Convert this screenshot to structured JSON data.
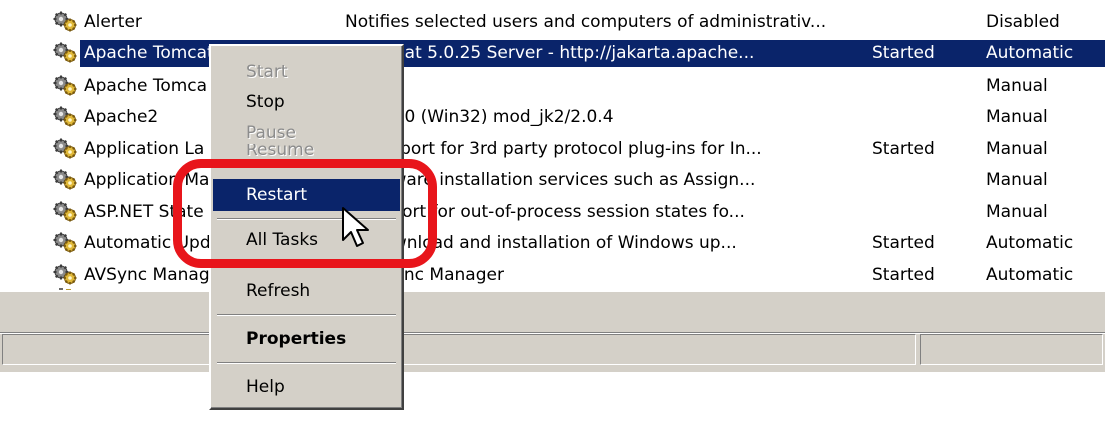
{
  "services": [
    {
      "name": "Alerter",
      "description": "Notifies selected users and computers of administrativ...",
      "status": "",
      "startup": "Disabled",
      "selected": false
    },
    {
      "name": "Apache Tomcat",
      "description": "e Tomcat 5.0.25 Server - http://jakarta.apache...",
      "status": "Started",
      "startup": "Automatic",
      "selected": true
    },
    {
      "name": "Apache Tomca",
      "description": "",
      "status": "",
      "startup": "Manual",
      "selected": false
    },
    {
      "name": "Apache2",
      "description": "e/2.0.50 (Win32) mod_jk2/2.0.4",
      "status": "",
      "startup": "Manual",
      "selected": false
    },
    {
      "name": "Application La",
      "description": "es support for 3rd party protocol plug-ins for In...",
      "status": "Started",
      "startup": "Manual",
      "selected": false
    },
    {
      "name": "Application Ma",
      "description": "es oftware installation services such as Assign...",
      "status": "",
      "startup": "Manual",
      "selected": false
    },
    {
      "name": "ASP.NET State",
      "description": "es upport for out-of-process session states fo...",
      "status": "",
      "startup": "Manual",
      "selected": false
    },
    {
      "name": "Automatic Upd",
      "description": "he download and installation of Windows up...",
      "status": "Started",
      "startup": "Automatic",
      "selected": false
    },
    {
      "name": "AVSync Manag",
      "description": "e AVSync Manager",
      "status": "Started",
      "startup": "Automatic",
      "selected": false
    }
  ],
  "context_menu": {
    "start": "Start",
    "stop": "Stop",
    "pause": "Pause",
    "resume": "Resume",
    "restart": "Restart",
    "all_tasks": "All Tasks",
    "refresh": "Refresh",
    "properties": "Properties",
    "help": "Help"
  },
  "colors": {
    "selection": "#0a246a",
    "callout": "#e8151b",
    "chrome": "#d4d0c8"
  },
  "icons": {
    "service": "gears-icon",
    "cursor": "arrow-cursor-icon"
  }
}
